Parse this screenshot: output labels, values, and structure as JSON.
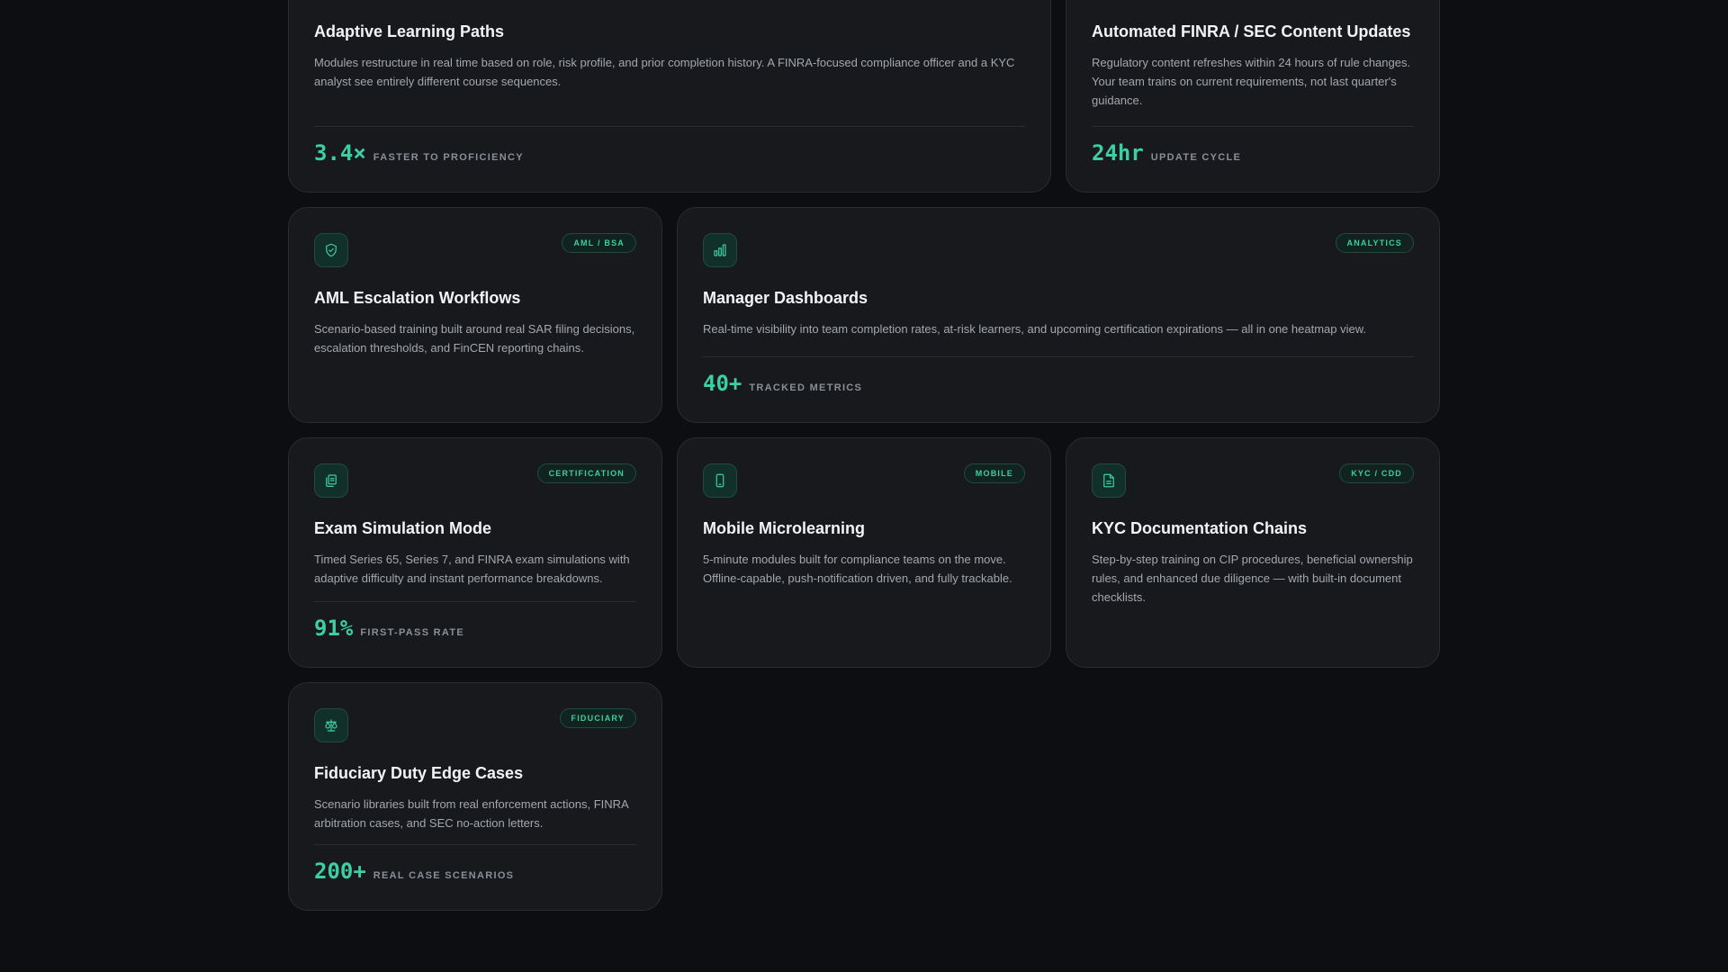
{
  "theme": {
    "background": "#0d0e11",
    "card": "#18191d",
    "accent": "#3ccf9f"
  },
  "cards": [
    {
      "title": "Adaptive Learning Paths",
      "description": "Modules restructure in real time based on role, risk profile, and prior completion history. A FINRA-focused compliance officer and a KYC analyst see entirely different course sequences.",
      "stat_value": "3.4×",
      "stat_label": "FASTER TO PROFICIENCY"
    },
    {
      "title": "Automated FINRA / SEC Content Updates",
      "description": "Regulatory content refreshes within 24 hours of rule changes. Your team trains on current requirements, not last quarter's guidance.",
      "stat_value": "24hr",
      "stat_label": "UPDATE CYCLE"
    },
    {
      "icon": "shield-check-icon",
      "badge": "AML / BSA",
      "title": "AML Escalation Workflows",
      "description": "Scenario-based training built around real SAR filing decisions, escalation thresholds, and FinCEN reporting chains."
    },
    {
      "icon": "bar-chart-icon",
      "badge": "ANALYTICS",
      "title": "Manager Dashboards",
      "description": "Real-time visibility into team completion rates, at-risk learners, and upcoming certification expirations — all in one heatmap view.",
      "stat_value": "40+",
      "stat_label": "TRACKED METRICS"
    },
    {
      "icon": "clipboard-copy-icon",
      "badge": "CERTIFICATION",
      "title": "Exam Simulation Mode",
      "description": "Timed Series 65, Series 7, and FINRA exam simulations with adaptive difficulty and instant performance breakdowns.",
      "stat_value": "91%",
      "stat_label": "FIRST-PASS RATE"
    },
    {
      "icon": "smartphone-icon",
      "badge": "MOBILE",
      "title": "Mobile Microlearning",
      "description": "5-minute modules built for compliance teams on the move. Offline-capable, push-notification driven, and fully trackable."
    },
    {
      "icon": "document-icon",
      "badge": "KYC / CDD",
      "title": "KYC Documentation Chains",
      "description": "Step-by-step training on CIP procedures, beneficial ownership rules, and enhanced due diligence — with built-in document checklists."
    },
    {
      "icon": "scales-icon",
      "badge": "FIDUCIARY",
      "title": "Fiduciary Duty Edge Cases",
      "description": "Scenario libraries built from real enforcement actions, FINRA arbitration cases, and SEC no-action letters.",
      "stat_value": "200+",
      "stat_label": "REAL CASE SCENARIOS"
    }
  ]
}
